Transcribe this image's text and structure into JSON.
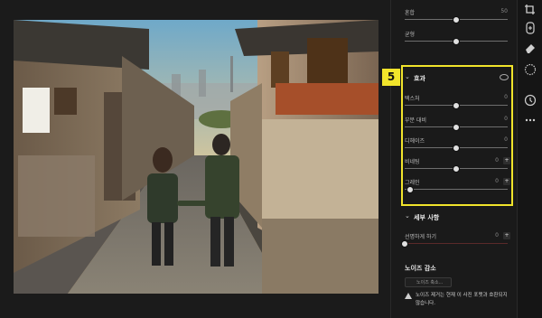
{
  "panel": {
    "top_sliders": [
      {
        "label": "혼합",
        "value": "50",
        "level": 0.5
      },
      {
        "label": "균형",
        "value": "",
        "level": 0.5
      }
    ],
    "effects": {
      "badge": "5",
      "title": "효과",
      "sliders": [
        {
          "label": "텍스처",
          "value": "0",
          "level": 0.5
        },
        {
          "label": "부분 대비",
          "value": "0",
          "level": 0.5
        },
        {
          "label": "디헤이즈",
          "value": "0",
          "level": 0.5
        },
        {
          "label": "비네팅",
          "value": "0",
          "level": 0.5
        },
        {
          "label": "그레인",
          "value": "0",
          "level": 0.05
        }
      ]
    },
    "detail": {
      "title": "세부 사항",
      "slider": {
        "label": "선명하게 하기",
        "value": "0",
        "level": 0.0
      }
    },
    "noise": {
      "title": "노이즈 감소",
      "button_label": "노이즈 축소...",
      "warning": "노이즈 제거는 현재 이 사진 포맷과 호환되지 않습니다."
    }
  },
  "rail_icons": [
    "crop-rotate-icon",
    "healing-icon",
    "eraser-icon",
    "mask-icon",
    "history-icon",
    "more-icon"
  ],
  "colors": {
    "accent": "#f1e42b"
  }
}
